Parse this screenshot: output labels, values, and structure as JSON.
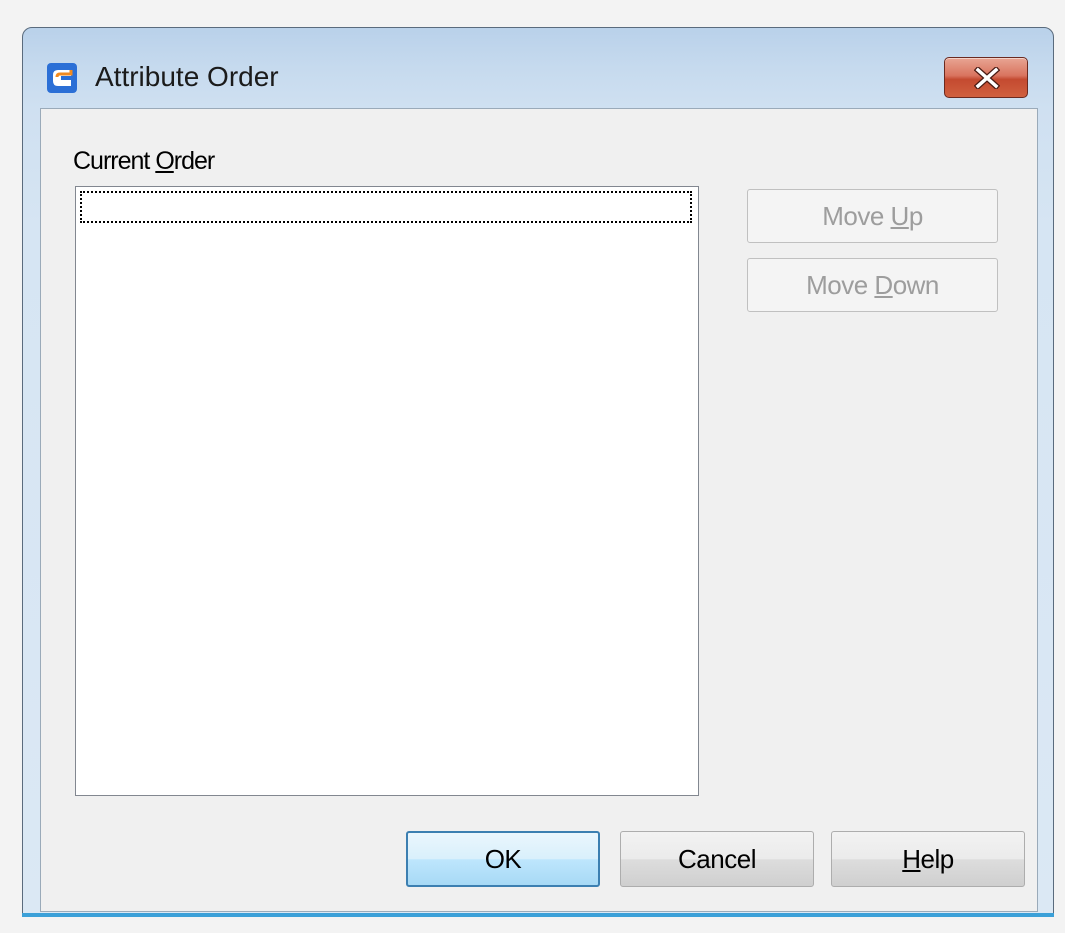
{
  "window": {
    "title": "Attribute Order",
    "icon": "app-logo-icon",
    "close_icon": "close-icon"
  },
  "current_order": {
    "label_before": "Current ",
    "label_mnemonic": "O",
    "label_after": "rder",
    "items": []
  },
  "buttons": {
    "move_up": {
      "before": "Move ",
      "mnemonic": "U",
      "after": "p",
      "enabled": false
    },
    "move_down": {
      "before": "Move ",
      "mnemonic": "D",
      "after": "own",
      "enabled": false
    },
    "ok": {
      "label": "OK",
      "default": true
    },
    "cancel": {
      "label": "Cancel"
    },
    "help": {
      "before": "",
      "mnemonic": "H",
      "after": "elp"
    }
  },
  "colors": {
    "titlebar": "#b9d1ea",
    "close_button": "#c44a30",
    "accent": "#3ba0d8",
    "default_button_border": "#3c7fb1"
  }
}
